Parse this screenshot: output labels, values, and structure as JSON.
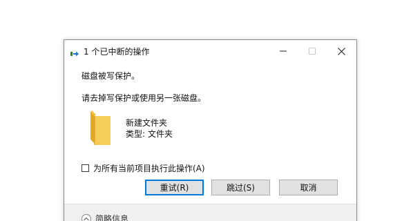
{
  "dialog": {
    "title": "1 个已中断的操作",
    "message": "磁盘被写保护。",
    "instruction": "请去掉写保护或使用另一张磁盘。",
    "file": {
      "name": "新建文件夹",
      "type_label": "类型:",
      "type_value": "文件夹",
      "icon": "folder-icon"
    },
    "apply_all_label": "为所有当前项目执行此操作(A)",
    "apply_all_checked": false,
    "buttons": {
      "retry": "重试(R)",
      "skip": "跳过(S)",
      "cancel": "取消"
    },
    "details_label": "简略信息"
  },
  "window_controls": {
    "minimize_icon": "minimize-icon",
    "maximize_icon": "maximize-icon",
    "close_icon": "close-icon"
  },
  "colors": {
    "folder": "#f5c84b",
    "accent": "#0078d7",
    "button_bg": "#e1e1e1",
    "footer_bg": "#f0f0f0"
  }
}
